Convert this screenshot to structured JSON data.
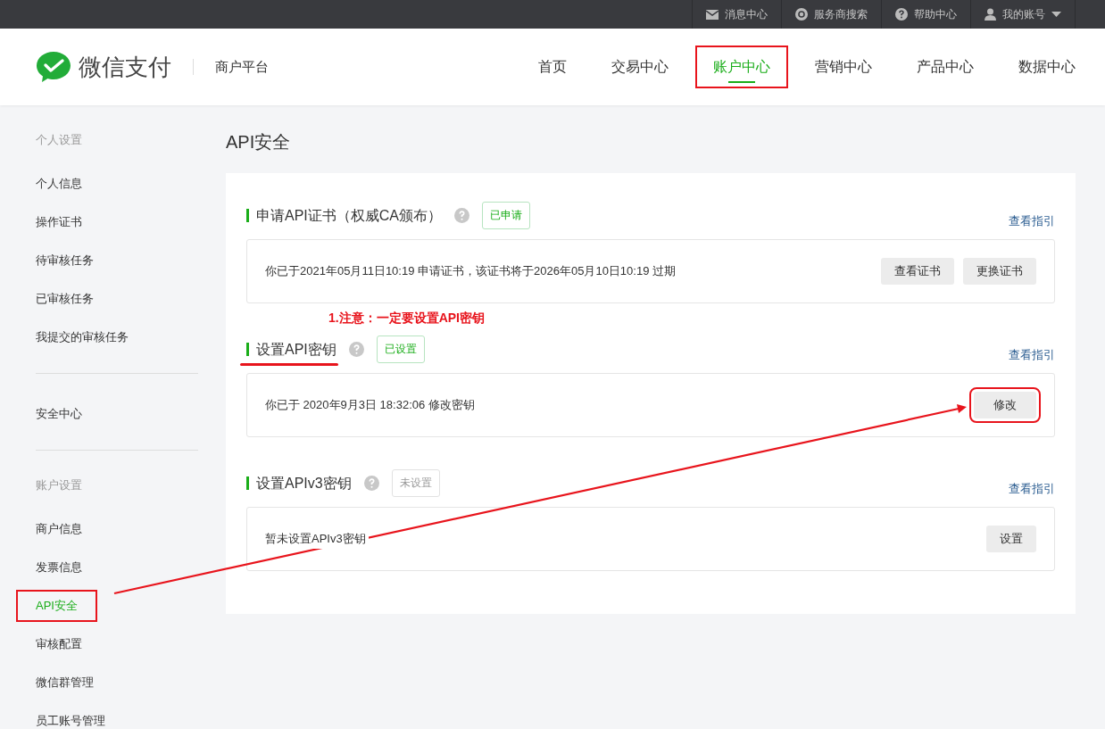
{
  "topbar": {
    "links": [
      {
        "label": "消息中心",
        "dropdown": false
      },
      {
        "label": "服务商搜索",
        "dropdown": false
      },
      {
        "label": "帮助中心",
        "dropdown": false
      },
      {
        "label": "我的账号",
        "dropdown": true
      }
    ]
  },
  "header": {
    "brand": "微信支付",
    "subtitle": "商户平台",
    "nav": [
      {
        "label": "首页",
        "selected": false,
        "highlighted": false
      },
      {
        "label": "交易中心",
        "selected": false,
        "highlighted": false
      },
      {
        "label": "账户中心",
        "selected": true,
        "highlighted": true
      },
      {
        "label": "营销中心",
        "selected": false,
        "highlighted": false
      },
      {
        "label": "产品中心",
        "selected": false,
        "highlighted": false
      },
      {
        "label": "数据中心",
        "selected": false,
        "highlighted": false
      }
    ]
  },
  "sidebar": {
    "groups": [
      {
        "title": "个人设置",
        "items": [
          {
            "label": "个人信息",
            "selected": false,
            "highlighted": false
          },
          {
            "label": "操作证书",
            "selected": false,
            "highlighted": false
          },
          {
            "label": "待审核任务",
            "selected": false,
            "highlighted": false
          },
          {
            "label": "已审核任务",
            "selected": false,
            "highlighted": false
          },
          {
            "label": "我提交的审核任务",
            "selected": false,
            "highlighted": false
          }
        ]
      },
      {
        "items": [
          {
            "label": "安全中心",
            "selected": false,
            "highlighted": false
          }
        ]
      },
      {
        "title": "账户设置",
        "items": [
          {
            "label": "商户信息",
            "selected": false,
            "highlighted": false
          },
          {
            "label": "发票信息",
            "selected": false,
            "highlighted": false
          },
          {
            "label": "API安全",
            "selected": true,
            "highlighted": true
          },
          {
            "label": "审核配置",
            "selected": false,
            "highlighted": false
          },
          {
            "label": "微信群管理",
            "selected": false,
            "highlighted": false
          },
          {
            "label": "员工账号管理",
            "selected": false,
            "highlighted": false
          }
        ]
      }
    ]
  },
  "page": {
    "title": "API安全",
    "sections": [
      {
        "title": "申请API证书（权威CA颁布）",
        "badge": {
          "label": "已申请",
          "kind": "done"
        },
        "link": "查看指引",
        "underlined": false,
        "text": "你已于2021年05月11日10:19 申请证书，该证书将于2026年05月10日10:19 过期",
        "buttons": [
          {
            "label": "查看证书",
            "highlighted": false
          },
          {
            "label": "更换证书",
            "highlighted": false
          }
        ]
      },
      {
        "note": "1.注意：一定要设置API密钥",
        "title": "设置API密钥",
        "badge": {
          "label": "已设置",
          "kind": "done"
        },
        "link": "查看指引",
        "underlined": true,
        "text": "你已于 2020年9月3日 18:32:06 修改密钥",
        "buttons": [
          {
            "label": "修改",
            "highlighted": true
          }
        ]
      },
      {
        "title": "设置APIv3密钥",
        "badge": {
          "label": "未设置",
          "kind": "none"
        },
        "link": "查看指引",
        "underlined": false,
        "text": "暂未设置APIv3密钥",
        "buttons": [
          {
            "label": "设置",
            "highlighted": false
          }
        ]
      }
    ]
  },
  "annotation_arrow": true
}
